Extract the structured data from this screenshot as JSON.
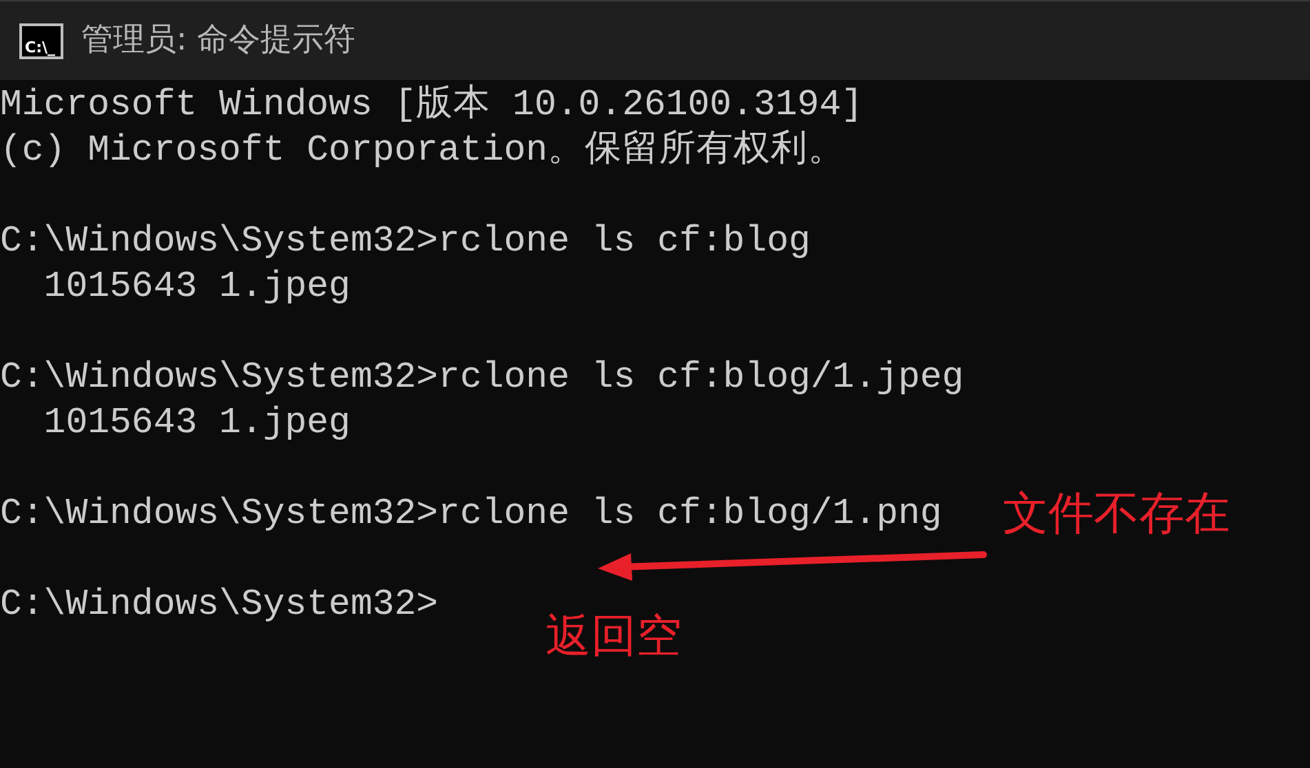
{
  "window": {
    "title": "管理员: 命令提示符",
    "icon_text": "C:\\_"
  },
  "terminal": {
    "blocks": [
      {
        "lines": [
          "Microsoft Windows [版本 10.0.26100.3194]",
          "(c) Microsoft Corporation。保留所有权利。"
        ]
      },
      {
        "lines": [
          "C:\\Windows\\System32>rclone ls cf:blog",
          "  1015643 1.jpeg"
        ]
      },
      {
        "lines": [
          "C:\\Windows\\System32>rclone ls cf:blog/1.jpeg",
          "  1015643 1.jpeg"
        ]
      },
      {
        "lines": [
          "C:\\Windows\\System32>rclone ls cf:blog/1.png"
        ]
      },
      {
        "lines": [
          "C:\\Windows\\System32>"
        ]
      }
    ]
  },
  "annotations": [
    {
      "text": "文件不存在"
    },
    {
      "text": "返回空"
    }
  ]
}
